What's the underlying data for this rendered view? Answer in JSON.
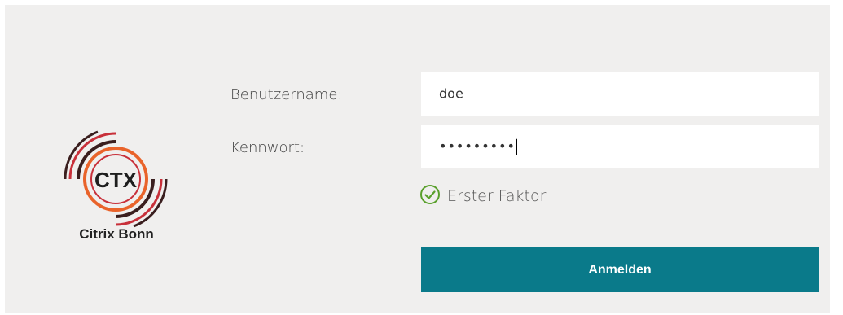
{
  "branding": {
    "logo_text": "CTX",
    "logo_caption": "Citrix Bonn",
    "logo_colors": [
      "#c8303a",
      "#e9632a",
      "#3a1e1e"
    ]
  },
  "form": {
    "username_label": "Benutzername:",
    "username_value": "doe",
    "password_label": "Kennwort:",
    "password_mask": "•••••••••",
    "factor_label": "Erster Faktor",
    "factor_icon": "check-circle-icon",
    "factor_color": "#5aa02c",
    "submit_label": "Anmelden",
    "submit_color": "#0a7a8a"
  }
}
